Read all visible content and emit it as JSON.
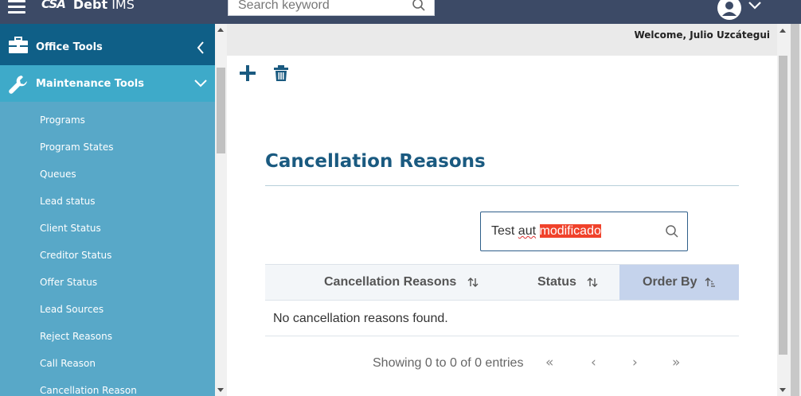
{
  "header": {
    "logo_mark": "CSA",
    "app_name_bold": "Debt",
    "app_name": " IMS",
    "search": {
      "placeholder": "Search keyword",
      "value": ""
    },
    "icons": [
      "menu-icon",
      "search-icon",
      "user-icon",
      "chevron-down-icon"
    ]
  },
  "sidebar": {
    "office_tools": {
      "label": "Office Tools",
      "icon": "toolbox-icon",
      "state": "collapsed"
    },
    "maintenance_tools": {
      "label": "Maintenance Tools",
      "icon": "wrench-icon",
      "state": "expanded"
    },
    "items": [
      {
        "label": "Programs"
      },
      {
        "label": "Program States"
      },
      {
        "label": "Queues"
      },
      {
        "label": "Lead status"
      },
      {
        "label": "Client Status"
      },
      {
        "label": "Creditor Status"
      },
      {
        "label": "Offer Status"
      },
      {
        "label": "Lead Sources"
      },
      {
        "label": "Reject Reasons"
      },
      {
        "label": "Call Reason"
      },
      {
        "label": "Cancellation Reason"
      }
    ]
  },
  "main": {
    "welcome": "Welcome, Julio Uzcátegui",
    "toolbar": {
      "add_icon": "plus-icon",
      "delete_icon": "trash-icon"
    },
    "title": "Cancellation Reasons",
    "filter": {
      "text_plain": "Test ",
      "text_misspelled": "aut",
      "text_space": " ",
      "text_selected": "modificado"
    },
    "table": {
      "columns": [
        {
          "label": "Cancellation Reasons",
          "sort": "both"
        },
        {
          "label": "Status",
          "sort": "both"
        },
        {
          "label": "Order By",
          "sort": "ascending",
          "active": true
        }
      ],
      "empty_message": "No cancellation reasons found."
    },
    "pagination": {
      "info": "Showing 0 to 0 of 0 entries",
      "first": "«",
      "prev": "‹",
      "next": "›",
      "last": "»"
    }
  },
  "colors": {
    "topbar": "#3c4a66",
    "sidebar": "#58a8c8",
    "office_header": "#0f5f87",
    "maintenance_header": "#3eaac9",
    "title": "#1a5a80",
    "active_column": "#c5d3ec",
    "selection": "#f0422b"
  }
}
